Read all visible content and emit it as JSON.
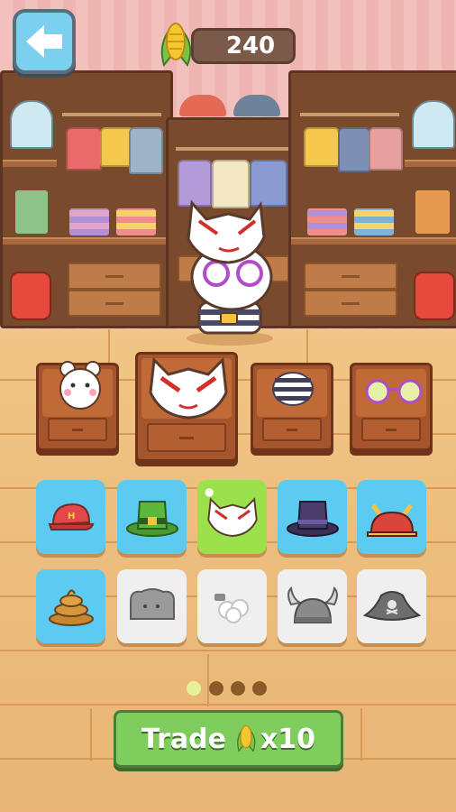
{
  "hud": {
    "back_icon": "arrow-left-icon",
    "currency_icon": "corn-icon",
    "currency_amount": "240"
  },
  "display_slots": [
    {
      "name": "hamster-character",
      "icon": "hamster-icon"
    },
    {
      "name": "fox-mask",
      "icon": "fox-mask-icon",
      "selected": true
    },
    {
      "name": "striped-shirt",
      "icon": "striped-shirt-icon"
    },
    {
      "name": "purple-glasses",
      "icon": "round-glasses-icon"
    }
  ],
  "items": [
    {
      "icon": "red-cap-icon",
      "state": "owned"
    },
    {
      "icon": "green-top-hat-icon",
      "state": "owned"
    },
    {
      "icon": "fox-mask-icon",
      "state": "equipped"
    },
    {
      "icon": "purple-top-hat-icon",
      "state": "owned"
    },
    {
      "icon": "samurai-helmet-icon",
      "state": "owned"
    },
    {
      "icon": "poop-hat-icon",
      "state": "owned"
    },
    {
      "icon": "toast-hat-icon",
      "state": "locked"
    },
    {
      "icon": "flower-hat-icon",
      "state": "locked"
    },
    {
      "icon": "viking-helmet-icon",
      "state": "locked"
    },
    {
      "icon": "pirate-hat-icon",
      "state": "locked"
    }
  ],
  "pagination": {
    "pages": 4,
    "current": 1
  },
  "trade": {
    "label": "Trade",
    "multiplier": "x10",
    "icon": "corn-icon"
  },
  "colors": {
    "tile_blue": "#5bcbf1",
    "tile_green": "#9be14b",
    "tile_gray": "#efefef",
    "trade_green": "#7fcd5c"
  }
}
